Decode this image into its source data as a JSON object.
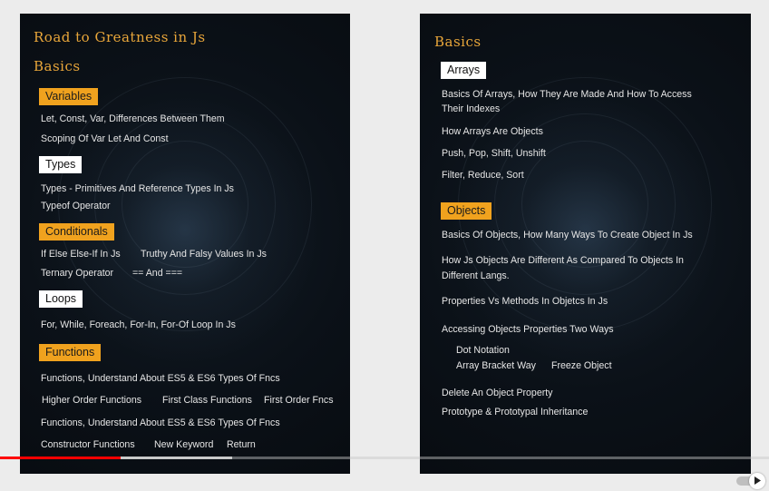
{
  "left_slide": {
    "title": "Road to Greatness in Js",
    "subtitle": "Basics",
    "tags": {
      "variables": "Variables",
      "types": "Types",
      "conditionals": "Conditionals",
      "loops": "Loops",
      "functions": "Functions"
    },
    "lines": {
      "var_1": "Let, Const, Var, Differences Between Them",
      "var_2": "Scoping Of Var Let And Const",
      "types_1": "Types - Primitives And Reference Types In Js",
      "types_2": "Typeof Operator",
      "cond_1a": "If Else Else-If In Js",
      "cond_1b": "Truthy And Falsy Values In Js",
      "cond_2a": "Ternary Operator",
      "cond_2b": "== And ===",
      "loops_1": "For, While, Foreach, For-In, For-Of  Loop In Js",
      "fn_1": "Functions, Understand About ES5 & ES6 Types Of Fncs",
      "fn_2a": "Higher Order Functions",
      "fn_2b": "First Class Functions",
      "fn_2c": "First Order Fncs",
      "fn_3": "Functions, Understand About ES5 & ES6 Types Of Fncs",
      "fn_4a": "Constructor Functions",
      "fn_4b": "New Keyword",
      "fn_4c": "Return"
    }
  },
  "right_slide": {
    "title": "Basics",
    "tags": {
      "arrays": "Arrays",
      "objects": "Objects"
    },
    "lines": {
      "arr_1a": "Basics Of Arrays, How They Are Made And How To Access",
      "arr_1b": "Their Indexes",
      "arr_2": "How Arrays Are Objects",
      "arr_3": "Push, Pop, Shift, Unshift",
      "arr_4": "Filter, Reduce, Sort",
      "obj_1": "Basics Of Objects, How Many Ways To Create Object In Js",
      "obj_2a": "How Js Objects Are Different As Compared To Objects In",
      "obj_2b": "Different Langs.",
      "obj_3": "Properties Vs Methods In Objetcs In Js",
      "obj_4": "Accessing Objects Properties Two Ways",
      "obj_5": "Dot Notation",
      "obj_6a": "Array Bracket Way",
      "obj_6b": "Freeze Object",
      "obj_7": "Delete An Object Property",
      "obj_8": "Prototype & Prototypal Inheritance"
    }
  },
  "player": {
    "played_fraction": 0.157,
    "buffered_fraction": 0.302,
    "autoplay_on": true,
    "accent_color": "#ff0000"
  },
  "colors": {
    "tag_orange": "#f0a21e",
    "heading_gold": "#e8a63a"
  }
}
